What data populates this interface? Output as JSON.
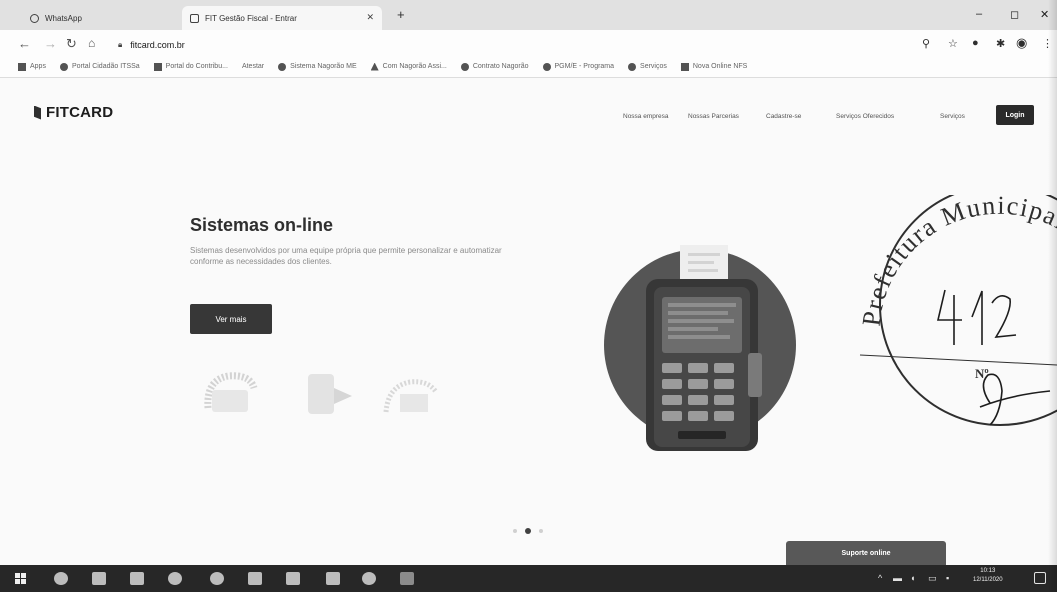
{
  "browser": {
    "tabs": [
      {
        "title": "WhatsApp"
      },
      {
        "title": "FIT Gestão Fiscal - Entrar"
      }
    ],
    "new_tab_icon": "plus-icon",
    "window_controls": {
      "minimize": "–",
      "maximize": "◻",
      "close": "✕"
    },
    "address": "fitcard.com.br",
    "bookmarks": [
      "Apps",
      "Portal Cidadão ITSSa",
      "Portal do Contribu...",
      "Atestar",
      "Sistema Nagorão ME",
      "Com Nagorão Assi...",
      "Contrato Nagorão",
      "PGM/E - Programa",
      "Serviços",
      "Nova Online NFS"
    ]
  },
  "site": {
    "logo": "FITCARD",
    "menu": [
      "Nossa empresa",
      "Nossas Parcerias",
      "Cadastre-se",
      "Serviços Oferecidos",
      "Serviços"
    ],
    "login_label": "Login",
    "hero": {
      "title": "Sistemas on-line",
      "description": "Sistemas desenvolvidos por uma equipe própria que permite personalizar e automatizar conforme as necessidades dos clientes.",
      "button_label": "Ver mais"
    },
    "chat_button": "Suporte online"
  },
  "stamp": {
    "text": "Prefeitura Municipal de",
    "number": "412",
    "numero_label": "Nº"
  },
  "taskbar": {
    "clock_time": "10:13",
    "clock_date": "12/11/2020"
  },
  "colors": {
    "dark_button": "#2e2e2e",
    "page_bg": "#f4f4f4",
    "taskbar": "#2b2b2b"
  }
}
